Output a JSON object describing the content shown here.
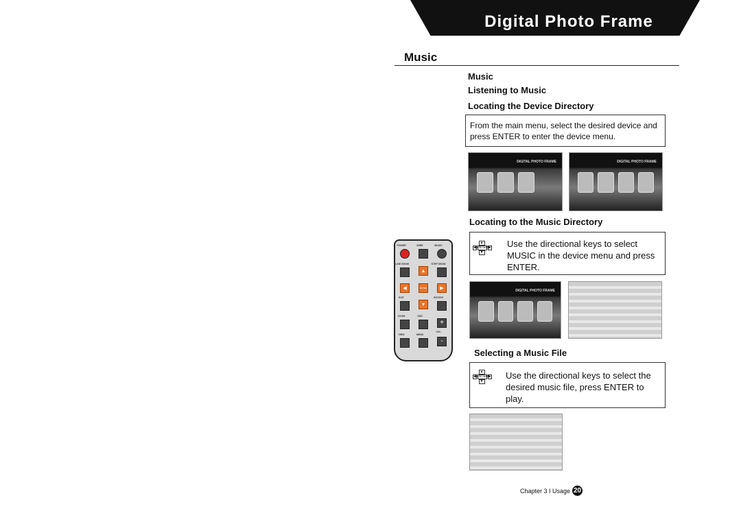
{
  "header": {
    "title": "Digital Photo Frame"
  },
  "section": {
    "title": "Music"
  },
  "content": {
    "h1": "Music",
    "h2": "Listening to Music",
    "s1": {
      "heading": "Locating the Device Directory",
      "text": "From the main menu, select the desired device and press ENTER  to enter  the device  menu."
    },
    "s2": {
      "heading": "Locating to the Music Directory",
      "text": "Use the directional keys to select MUSIC in the device menu and press ENTER."
    },
    "s3": {
      "heading": "Selecting a Music File",
      "text": "Use the directional keys to select the desired music file, press ENTER to play."
    },
    "key_enter": "ENTER",
    "screen_brand": "DIGITAL PHOTO FRAME"
  },
  "remote": {
    "labels": [
      "POWER",
      "WIRE",
      "MUSIC",
      "SLIDE SHOW",
      "STEP SHOW",
      "EXIT",
      "ROTATE",
      "ZOOM",
      "OSD",
      "VIEW",
      "MENU",
      "VOL"
    ],
    "enter": "ENTER",
    "plus": "+",
    "minus": "-"
  },
  "footer": {
    "chapter": "Chapter 3 I Usage",
    "page": "20"
  }
}
